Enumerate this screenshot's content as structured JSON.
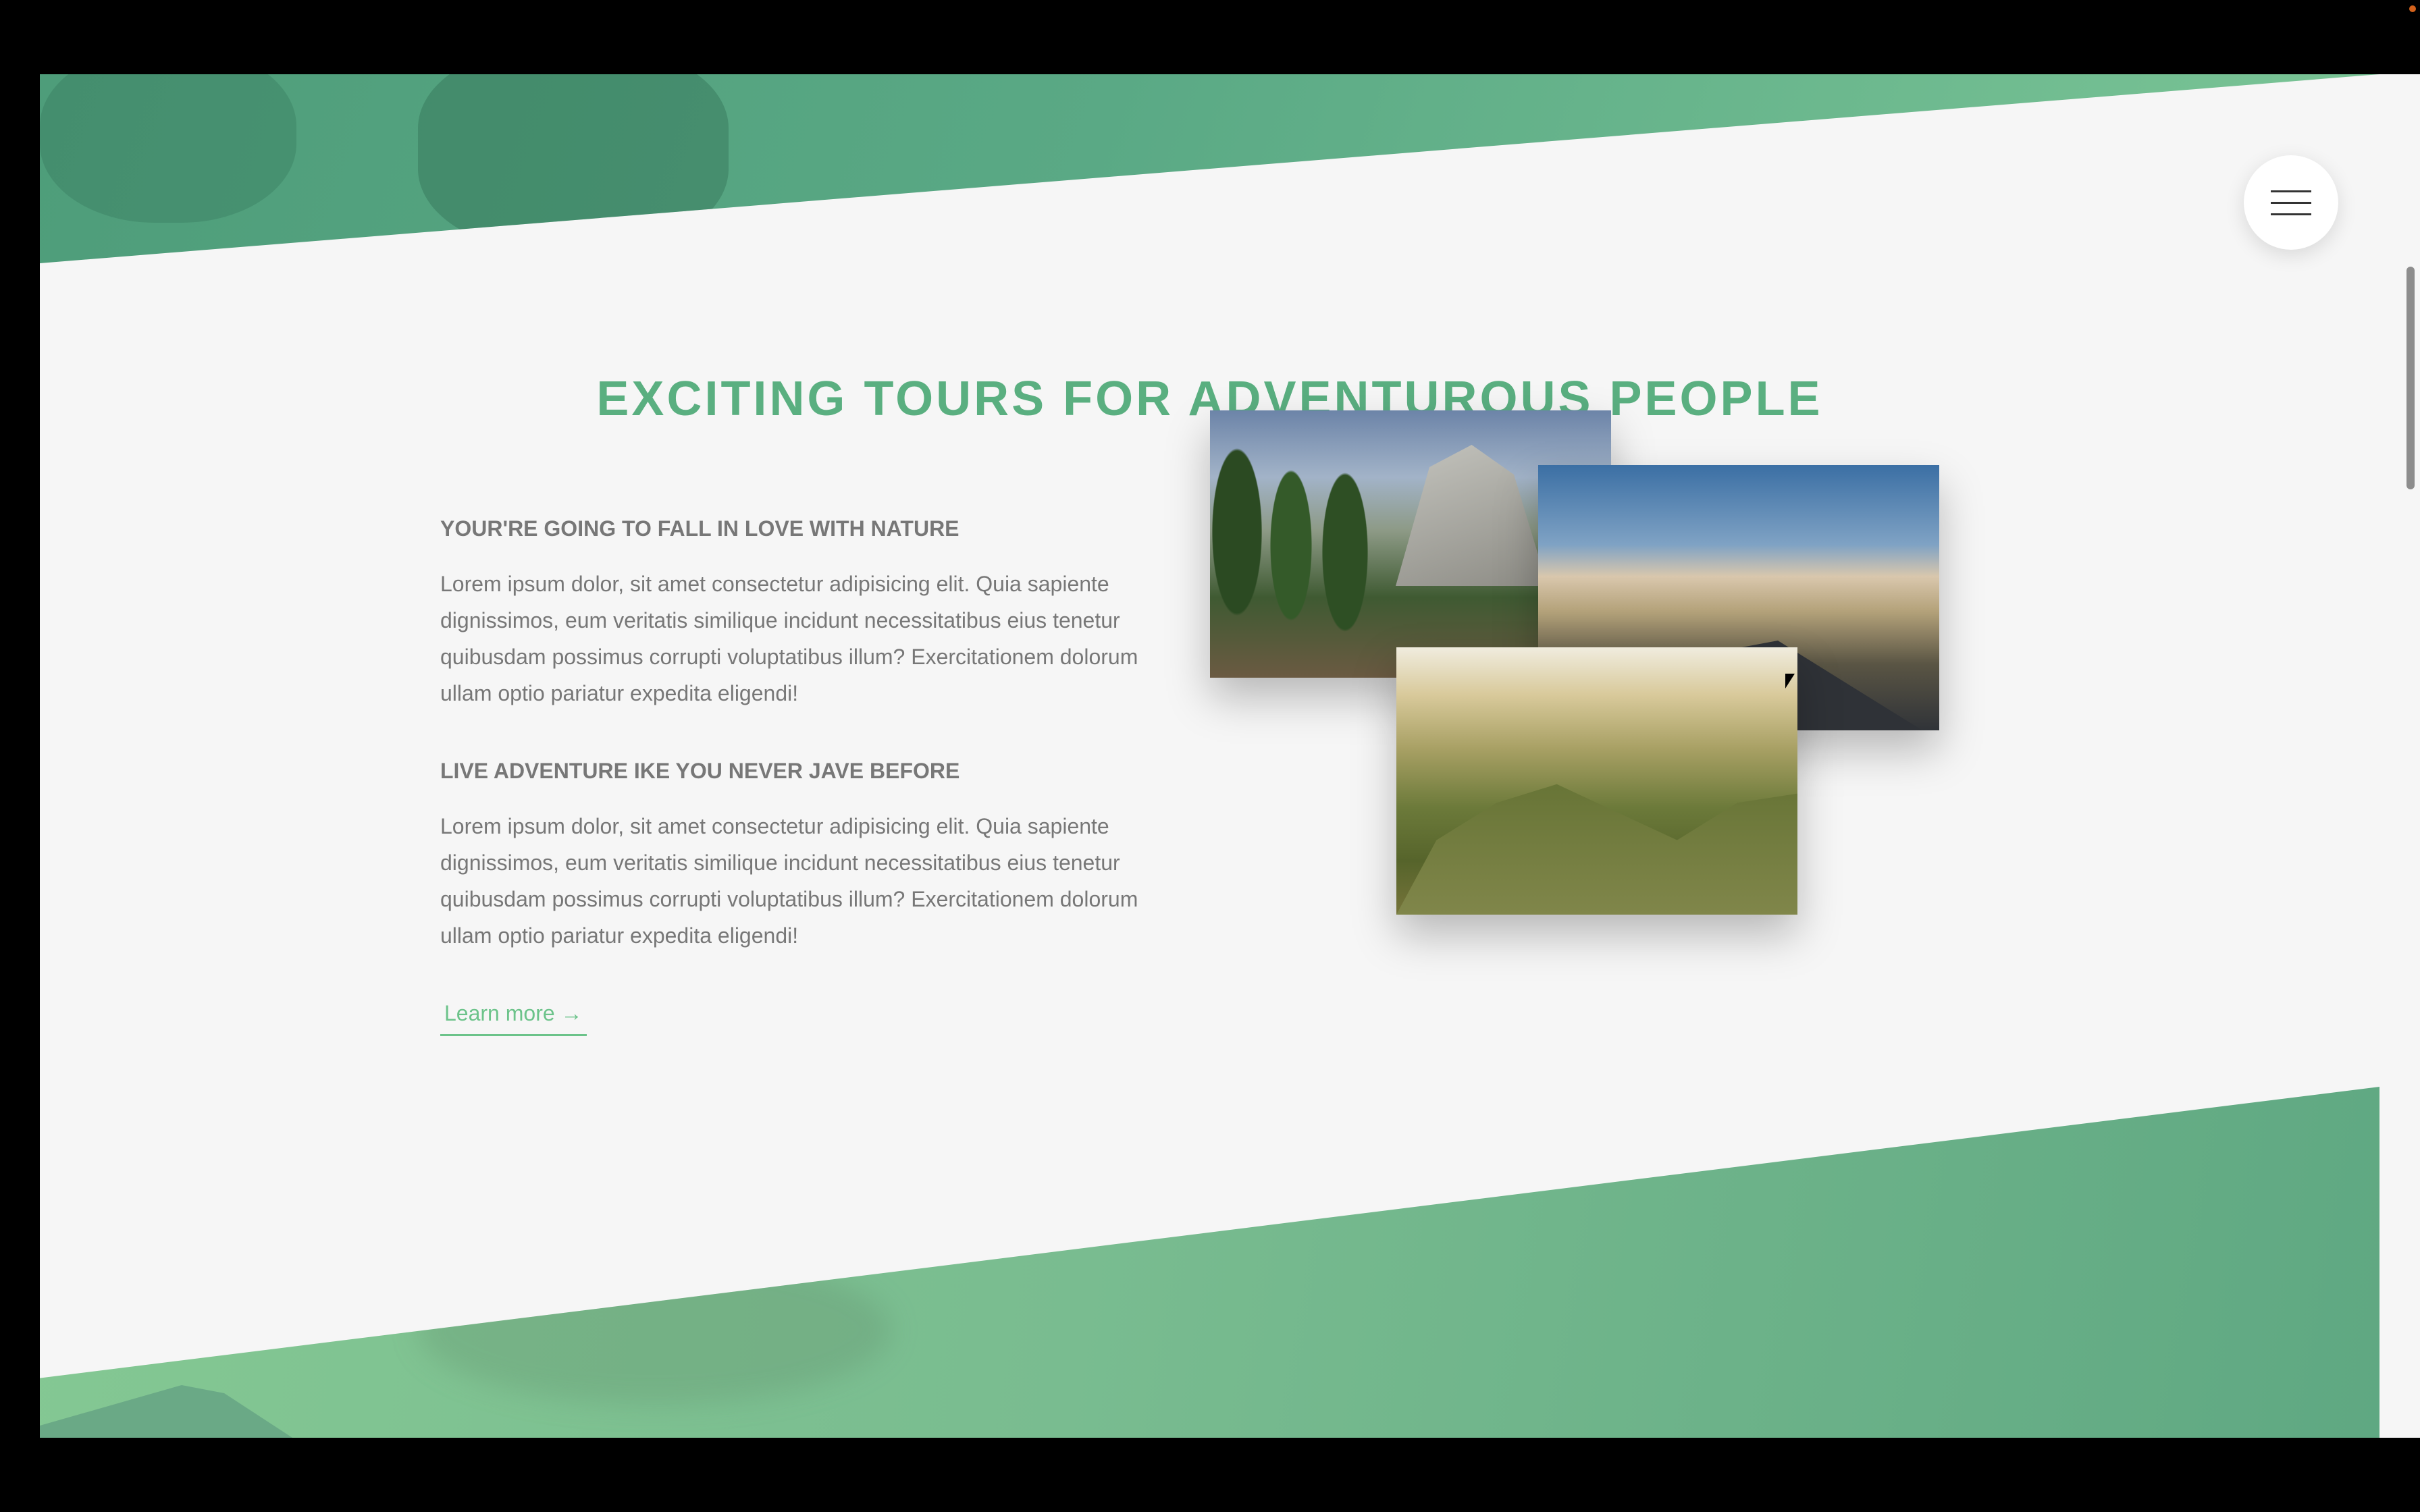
{
  "section": {
    "title": "EXCITING TOURS FOR ADVENTUROUS PEOPLE"
  },
  "features": [
    {
      "heading": "YOUR'RE GOING TO FALL IN LOVE WITH NATURE",
      "body": "Lorem ipsum dolor, sit amet consectetur adipisicing elit. Quia sapiente dignissimos, eum veritatis similique incidunt necessitatibus eius tenetur quibusdam possimus corrupti voluptatibus illum? Exercitationem dolorum ullam optio pariatur expedita eligendi!"
    },
    {
      "heading": "LIVE ADVENTURE IKE YOU NEVER JAVE BEFORE",
      "body": "Lorem ipsum dolor, sit amet consectetur adipisicing elit. Quia sapiente dignissimos, eum veritatis similique incidunt necessitatibus eius tenetur quibusdam possimus corrupti voluptatibus illum? Exercitationem dolorum ullam optio pariatur expedita eligendi!"
    }
  ],
  "cta": {
    "label": "Learn more →"
  },
  "icons": {
    "menu": "hamburger-menu-icon"
  },
  "colors": {
    "accent": "#5aaf80",
    "link": "#6cc38a",
    "background": "#f6f6f6",
    "text": "#777777"
  }
}
